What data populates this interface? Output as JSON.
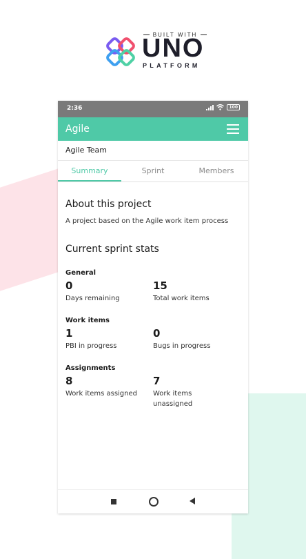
{
  "brand": {
    "built_with": "BUILT WITH",
    "name": "UNO",
    "platform": "PLATFORM"
  },
  "status_bar": {
    "time": "2:36",
    "battery": "100"
  },
  "app_bar": {
    "title": "Agile"
  },
  "team": {
    "name": "Agile Team"
  },
  "tabs": [
    {
      "label": "Summary",
      "active": true
    },
    {
      "label": "Sprint",
      "active": false
    },
    {
      "label": "Members",
      "active": false
    }
  ],
  "about": {
    "heading": "About this project",
    "description": "A project based on the Agile work item process"
  },
  "stats": {
    "heading": "Current sprint stats",
    "groups": [
      {
        "title": "General",
        "items": [
          {
            "value": "0",
            "label": "Days remaining"
          },
          {
            "value": "15",
            "label": "Total work items"
          }
        ]
      },
      {
        "title": "Work items",
        "items": [
          {
            "value": "1",
            "label": "PBI in progress"
          },
          {
            "value": "0",
            "label": "Bugs in progress"
          }
        ]
      },
      {
        "title": "Assignments",
        "items": [
          {
            "value": "8",
            "label": "Work items assigned"
          },
          {
            "value": "7",
            "label": "Work items unassigned"
          }
        ]
      }
    ]
  },
  "colors": {
    "accent": "#4fc9a7",
    "status_bar": "#7a7a7a"
  }
}
